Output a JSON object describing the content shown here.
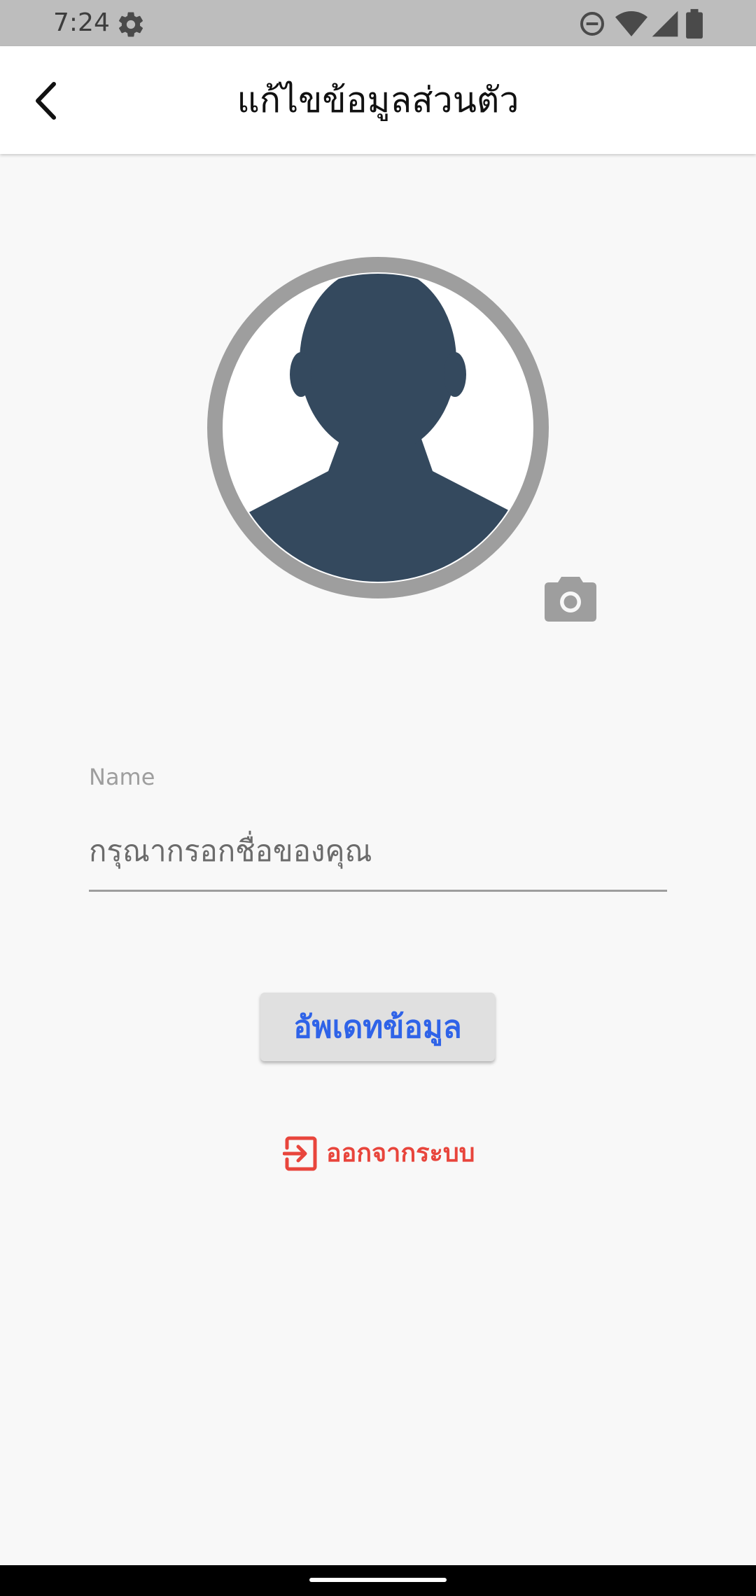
{
  "status_bar": {
    "time": "7:24",
    "icons": [
      "gear-icon",
      "do-not-disturb-icon",
      "wifi-icon",
      "signal-icon",
      "battery-icon"
    ]
  },
  "header": {
    "title": "แก้ไขข้อมูลส่วนตัว",
    "back_icon": "chevron-left-icon"
  },
  "profile": {
    "avatar_icon": "person-silhouette-icon",
    "camera_icon": "camera-icon"
  },
  "form": {
    "name_label": "Name",
    "name_value": "",
    "name_placeholder": "กรุณากรอกชื่อของคุณ",
    "update_label": "อัพเดทข้อมูล"
  },
  "logout": {
    "label": "ออกจากระบบ",
    "icon": "logout-icon"
  },
  "colors": {
    "status_bar": "#bdbdbd",
    "background": "#f8f8f8",
    "avatar_ring": "#9e9e9e",
    "avatar_figure": "#34495e",
    "update_text": "#2f63e8",
    "logout": "#e8453c"
  }
}
